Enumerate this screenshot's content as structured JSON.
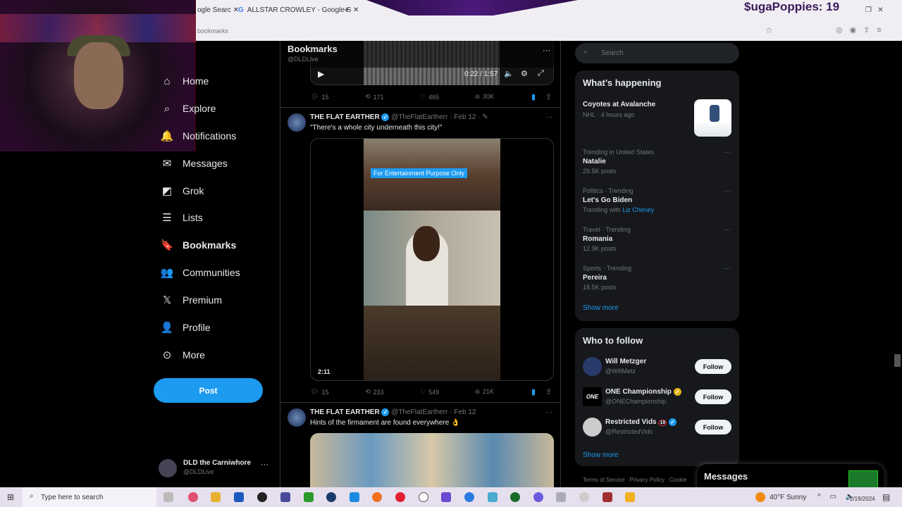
{
  "browser": {
    "tabs": [
      "ogle Searc",
      "ALLSTAR CROWLEY - Google S"
    ],
    "address": "bookmarks",
    "overlay_text": "$ugaPoppies: 19"
  },
  "nav": {
    "items": [
      {
        "label": "Home",
        "icon": "home-icon"
      },
      {
        "label": "Explore",
        "icon": "search-icon"
      },
      {
        "label": "Notifications",
        "icon": "bell-icon"
      },
      {
        "label": "Messages",
        "icon": "mail-icon"
      },
      {
        "label": "Grok",
        "icon": "grok-icon"
      },
      {
        "label": "Lists",
        "icon": "list-icon"
      },
      {
        "label": "Bookmarks",
        "icon": "bookmark-icon"
      },
      {
        "label": "Communities",
        "icon": "people-icon"
      },
      {
        "label": "Premium",
        "icon": "x-icon"
      },
      {
        "label": "Profile",
        "icon": "person-icon"
      },
      {
        "label": "More",
        "icon": "more-circle-icon"
      }
    ],
    "post": "Post",
    "account": {
      "name": "DLD the Carniwhore",
      "handle": "@DLDLive"
    }
  },
  "header": {
    "title": "Bookmarks",
    "handle": "@DLDLive"
  },
  "tweets": [
    {
      "video_time": "0:22 / 1:57",
      "replies": "15",
      "retweets": "171",
      "likes": "465",
      "views": "30K"
    },
    {
      "author": "THE FLAT EARTHER",
      "handle": "@TheFlatEartherr",
      "date": "· Feb 12 ·",
      "text": "\"There's a whole city underneath this city!\"",
      "overlay": "For Entertainment Purpose Only",
      "duration": "2:11",
      "replies": "15",
      "retweets": "233",
      "likes": "549",
      "views": "21K"
    },
    {
      "author": "THE FLAT EARTHER",
      "handle": "@TheFlatEartherr",
      "date": "· Feb 12",
      "text": "Hints of the firmament are found everywhere 👌"
    }
  ],
  "search": {
    "placeholder": "Search"
  },
  "happening": {
    "title": "What’s happening",
    "featured": {
      "title": "Coyotes at Avalanche",
      "meta": "NHL · 4 hours ago"
    },
    "trends": [
      {
        "context": "Trending in United States",
        "name": "Natalie",
        "posts": "29.5K posts"
      },
      {
        "context": "Politics · Trending",
        "name": "Let's Go Biden",
        "posts": "Trending with",
        "link": "Liz Cheney"
      },
      {
        "context": "Travel · Trending",
        "name": "Romania",
        "posts": "12.9K posts"
      },
      {
        "context": "Sports · Trending",
        "name": "Pereira",
        "posts": "18.5K posts"
      }
    ],
    "show_more": "Show more"
  },
  "who": {
    "title": "Who to follow",
    "users": [
      {
        "name": "Will Metzger",
        "handle": "@WillMetz"
      },
      {
        "name": "ONE Championship",
        "handle": "@ONEChampionship"
      },
      {
        "name": "Restricted Vids",
        "handle": "@RestrictedVids",
        "badge": "18"
      }
    ],
    "follow": "Follow",
    "show_more": "Show more"
  },
  "footer": {
    "links": [
      "Terms of Service",
      "Privacy Policy",
      "Cookie"
    ]
  },
  "messages": {
    "title": "Messages"
  },
  "taskbar": {
    "search": "Type here to search",
    "weather": "40°F  Sunny",
    "date": "2/19/2024"
  }
}
